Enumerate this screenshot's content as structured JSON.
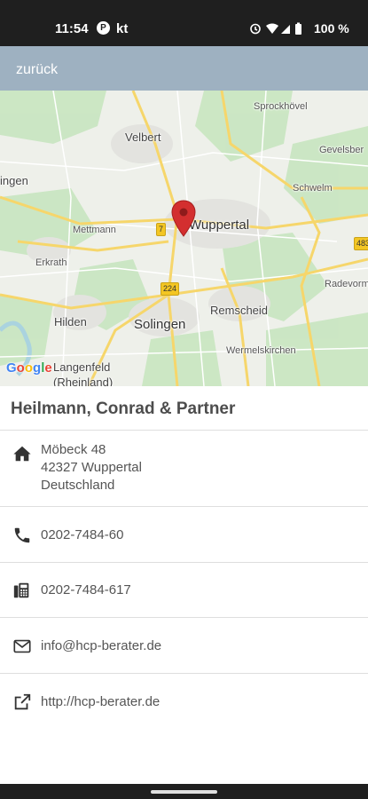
{
  "status_bar": {
    "time": "11:54",
    "app_badge": "P",
    "carrier": "kt",
    "battery": "100 %",
    "icons": [
      "alarm-icon",
      "wifi-icon",
      "signal-icon",
      "battery-icon"
    ]
  },
  "app_bar": {
    "back_label": "zurück",
    "color": "#9eb1c1"
  },
  "map": {
    "places": {
      "sprockhovel": "Sprockhövel",
      "velbert": "Velbert",
      "gevelsberg": "Gevelsber",
      "ingen": "ingen",
      "schwelm": "Schwelm",
      "mettmann": "Mettmann",
      "wuppertal": "Wuppertal",
      "erkrath": "Erkrath",
      "radevorm": "Radevorm",
      "hilden": "Hilden",
      "solingen": "Solingen",
      "remscheid": "Remscheid",
      "wermelskirchen": "Wermelskirchen",
      "langenfeld": "Langenfeld",
      "rheinland": "(Rheinland)"
    },
    "shields": {
      "s7": "7",
      "s224": "224",
      "s483": "483"
    },
    "logo": "Google",
    "marker_color": "#d32f2f"
  },
  "company": {
    "name": "Heilmann, Conrad & Partner"
  },
  "contact": {
    "address": {
      "street": "Möbeck 48",
      "city": "42327 Wuppertal",
      "country": "Deutschland",
      "icon": "home-icon"
    },
    "phone": {
      "value": "0202-7484-60",
      "icon": "phone-icon"
    },
    "fax": {
      "value": "0202-7484-617",
      "icon": "fax-icon"
    },
    "email": {
      "value": "info@hcp-berater.de",
      "icon": "mail-icon"
    },
    "web": {
      "value": "http://hcp-berater.de",
      "icon": "external-link-icon"
    }
  }
}
